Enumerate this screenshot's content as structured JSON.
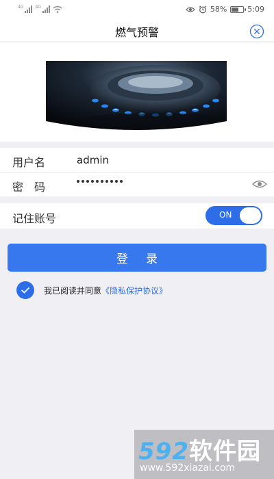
{
  "status_bar": {
    "net_tag_1": "4G",
    "net_tag_2": "4G",
    "battery": "58%",
    "battery_level": 0.58,
    "time": "5:09"
  },
  "header": {
    "title": "燃气预警",
    "close_icon": "close-circle-icon"
  },
  "banner": {
    "image": "gas-stove-burner-flame"
  },
  "form": {
    "username_label": "用户名",
    "username_value": "admin",
    "password_label": "密　码",
    "password_masked_length": 10,
    "password_toggle_icon": "eye-icon",
    "remember_label": "记住账号",
    "remember_toggle_text": "ON"
  },
  "login_button": "登录",
  "agreement": {
    "checked": true,
    "text": "我已阅读并同意",
    "link": "《隐私保护协议》"
  },
  "watermark": {
    "digits": "592",
    "brand": "软件园",
    "url": "www.592xiazai.com"
  },
  "colors": {
    "accent": "#2d6ee8",
    "button": "#3778ee",
    "background": "#efeff4"
  }
}
